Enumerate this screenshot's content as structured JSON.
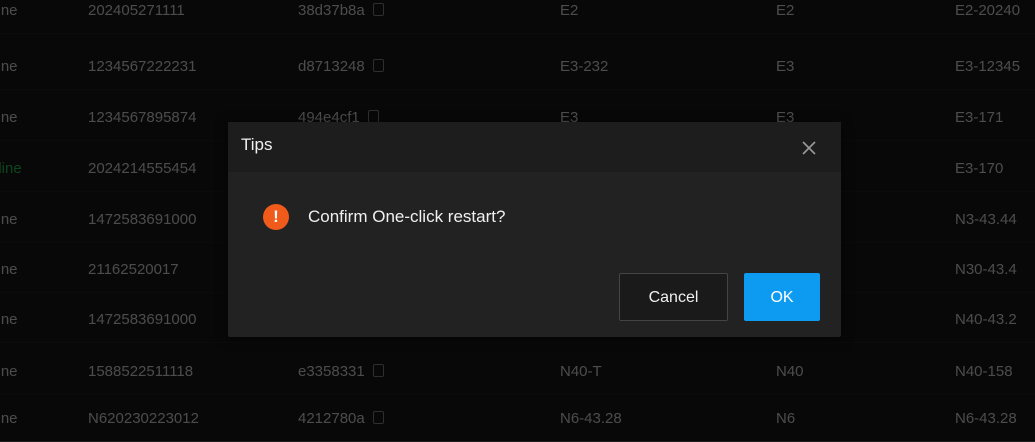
{
  "table": {
    "rows": [
      {
        "status": "fline",
        "sn": "202405271111",
        "mac": "38d37b8a",
        "name": "E2",
        "model": "E2",
        "version": "E2-20240"
      },
      {
        "status": "fline",
        "sn": "1234567222231",
        "mac": "d8713248",
        "name": "E3-232",
        "model": "E3",
        "version": "E3-12345"
      },
      {
        "status": "fline",
        "sn": "1234567895874",
        "mac": "494e4cf1",
        "name": "E3",
        "model": "E3",
        "version": "E3-171"
      },
      {
        "status": "nline",
        "sn": "2024214555454",
        "mac": "",
        "name": "",
        "model": "",
        "version": "E3-170"
      },
      {
        "status": "fline",
        "sn": "1472583691000",
        "mac": "",
        "name": "",
        "model": "",
        "version": "N3-43.44"
      },
      {
        "status": "fline",
        "sn": "21162520017",
        "mac": "",
        "name": "",
        "model": "",
        "version": "N30-43.4"
      },
      {
        "status": "fline",
        "sn": "1472583691000",
        "mac": "",
        "name": "",
        "model": "",
        "version": "N40-43.2"
      },
      {
        "status": "fline",
        "sn": "1588522511118",
        "mac": "e3358331",
        "name": "N40-T",
        "model": "N40",
        "version": "N40-158"
      },
      {
        "status": "fline",
        "sn": "N620230223012",
        "mac": "4212780a",
        "name": "N6-43.28",
        "model": "N6",
        "version": "N6-43.28"
      }
    ]
  },
  "dialog": {
    "title": "Tips",
    "message": "Confirm One-click restart?",
    "cancel_label": "Cancel",
    "ok_label": "OK",
    "icon": "exclamation-icon",
    "icon_glyph": "!"
  },
  "colors": {
    "online": "#27b24f",
    "warning": "#f05a1a",
    "primary": "#0d9bf2"
  }
}
